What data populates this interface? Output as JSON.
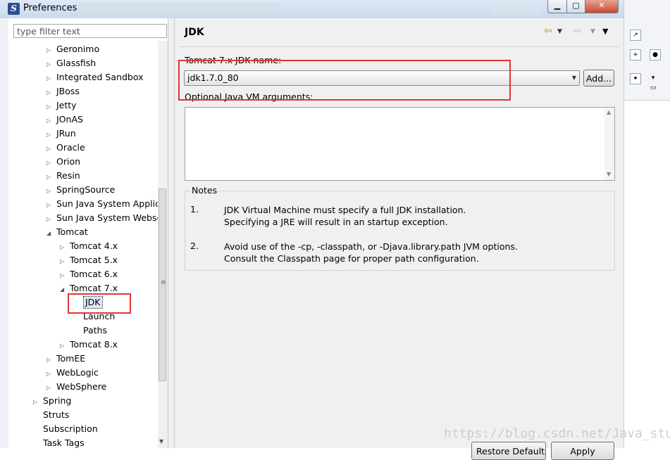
{
  "window": {
    "title": "Preferences"
  },
  "filter": {
    "placeholder": "type filter text"
  },
  "tree": [
    {
      "label": "Geronimo",
      "twisty": "▷"
    },
    {
      "label": "Glassfish",
      "twisty": "▷"
    },
    {
      "label": "Integrated Sandbox",
      "twisty": "▷"
    },
    {
      "label": "JBoss",
      "twisty": "▷"
    },
    {
      "label": "Jetty",
      "twisty": "▷"
    },
    {
      "label": "JOnAS",
      "twisty": "▷"
    },
    {
      "label": "JRun",
      "twisty": "▷"
    },
    {
      "label": "Oracle",
      "twisty": "▷"
    },
    {
      "label": "Orion",
      "twisty": "▷"
    },
    {
      "label": "Resin",
      "twisty": "▷"
    },
    {
      "label": "SpringSource",
      "twisty": "▷"
    },
    {
      "label": "Sun Java System Applica",
      "twisty": "▷"
    },
    {
      "label": "Sun Java System Webse",
      "twisty": "▷"
    },
    {
      "label": "Tomcat",
      "twisty": "◢"
    },
    {
      "label": "Tomcat  4.x",
      "twisty": "▷"
    },
    {
      "label": "Tomcat  5.x",
      "twisty": "▷"
    },
    {
      "label": "Tomcat  6.x",
      "twisty": "▷"
    },
    {
      "label": "Tomcat  7.x",
      "twisty": "◢"
    },
    {
      "label": "JDK",
      "twisty": "",
      "selected": true
    },
    {
      "label": "Launch",
      "twisty": ""
    },
    {
      "label": "Paths",
      "twisty": ""
    },
    {
      "label": "Tomcat  8.x",
      "twisty": "▷"
    },
    {
      "label": "TomEE",
      "twisty": "▷"
    },
    {
      "label": "WebLogic",
      "twisty": "▷"
    },
    {
      "label": "WebSphere",
      "twisty": "▷"
    },
    {
      "label": "Spring",
      "twisty": "▷"
    },
    {
      "label": "Struts",
      "twisty": ""
    },
    {
      "label": "Subscription",
      "twisty": ""
    },
    {
      "label": "Task Tags",
      "twisty": ""
    }
  ],
  "page": {
    "title": "JDK",
    "jdk_label": "Tomcat  7.x JDK name:",
    "jdk_value": "jdk1.7.0_80",
    "add_label": "Add...",
    "vm_label": "Optional Java VM arguments:",
    "vm_value": "",
    "notes_title": "Notes",
    "notes": [
      {
        "num": "1.",
        "line1": "JDK Virtual Machine must specify a full JDK installation.",
        "line2": "Specifying a JRE will result in an startup exception."
      },
      {
        "num": "2.",
        "line1": "Avoid use of the -cp, -classpath, or -Djava.library.path JVM options.",
        "line2": "Consult the Classpath page for proper path configuration."
      }
    ],
    "restore_label": "Restore Defaults",
    "apply_label": "Apply"
  },
  "icons": {
    "app": "eclipse-icon",
    "back": "back-arrow-icon",
    "forward": "forward-arrow-icon",
    "menu": "view-menu-icon"
  },
  "colors": {
    "highlight": "#e23434",
    "nav_arrow": "#c98f14",
    "selection": "#dbe8f8"
  },
  "watermark": "https://blog.csdn.net/Java_stud"
}
